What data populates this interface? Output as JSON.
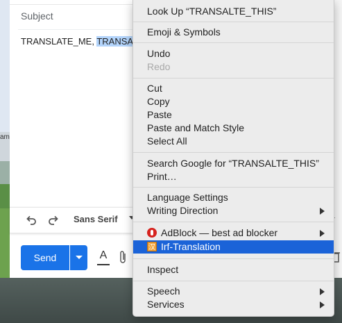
{
  "compose": {
    "subject_placeholder": "Subject",
    "body_plain": "TRANSLATE_ME, ",
    "body_selected": "TRANSA",
    "side_char": "am",
    "font_name": "Sans Serif",
    "send_label": "Send",
    "format_label": "A"
  },
  "context_menu": {
    "items": [
      {
        "label": "Look Up “TRANSALTE_THIS”"
      },
      {
        "label": "Emoji & Symbols"
      },
      {
        "label": "Undo"
      },
      {
        "label": "Redo",
        "disabled": true
      },
      {
        "label": "Cut"
      },
      {
        "label": "Copy"
      },
      {
        "label": "Paste"
      },
      {
        "label": "Paste and Match Style"
      },
      {
        "label": "Select All"
      },
      {
        "label": "Search Google for “TRANSALTE_THIS”"
      },
      {
        "label": "Print…"
      },
      {
        "label": "Language Settings"
      },
      {
        "label": "Writing Direction",
        "submenu": true
      },
      {
        "label": "AdBlock — best ad blocker",
        "submenu": true,
        "icon": "adblock-icon"
      },
      {
        "label": "Irf-Translation",
        "highlighted": true,
        "icon": "irf-translation-icon"
      },
      {
        "label": "Inspect"
      },
      {
        "label": "Speech",
        "submenu": true
      },
      {
        "label": "Services",
        "submenu": true
      }
    ],
    "highlight_color": "#1b63d8"
  },
  "colors": {
    "send_button": "#1a73e8",
    "selection": "#b3d4fb"
  }
}
